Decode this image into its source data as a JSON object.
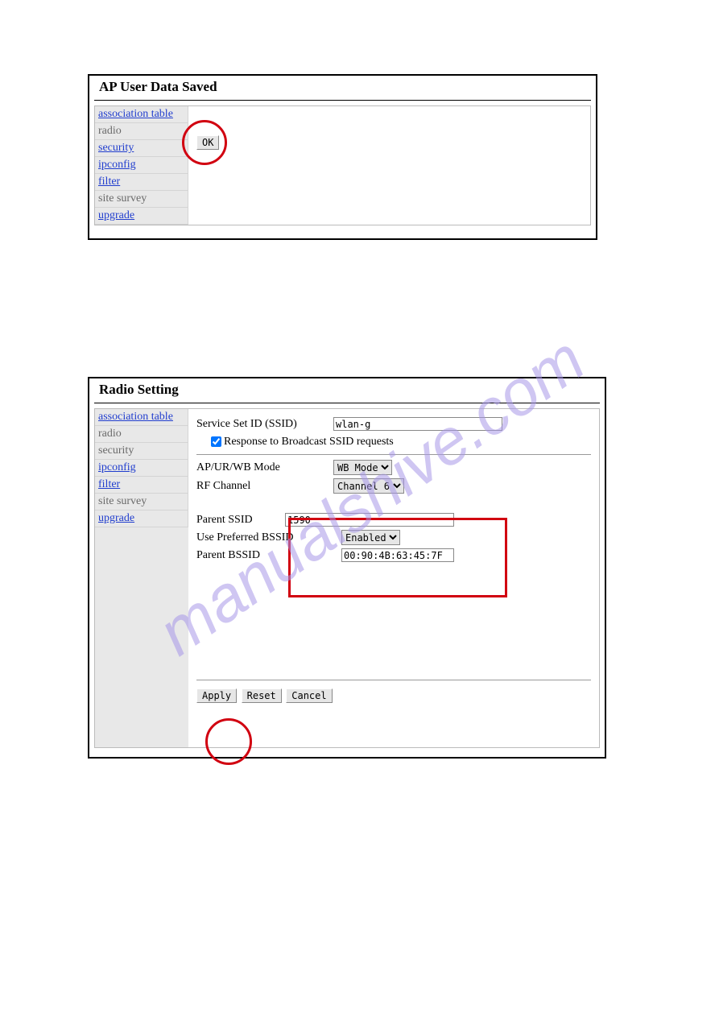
{
  "watermark": "manualshive.com",
  "panel1": {
    "title": "AP User Data Saved",
    "sidebar": [
      {
        "label": "association table",
        "style": "link"
      },
      {
        "label": "radio",
        "style": "plain"
      },
      {
        "label": "security",
        "style": "link"
      },
      {
        "label": "ipconfig",
        "style": "link"
      },
      {
        "label": "filter",
        "style": "link"
      },
      {
        "label": "site survey",
        "style": "plain"
      },
      {
        "label": "upgrade",
        "style": "link"
      }
    ],
    "ok_label": "OK"
  },
  "panel2": {
    "title": "Radio Setting",
    "sidebar": [
      {
        "label": "association table",
        "style": "link"
      },
      {
        "label": "radio",
        "style": "plain"
      },
      {
        "label": "security",
        "style": "plain"
      },
      {
        "label": "ipconfig",
        "style": "link"
      },
      {
        "label": "filter",
        "style": "link"
      },
      {
        "label": "site survey",
        "style": "plain"
      },
      {
        "label": "upgrade",
        "style": "link"
      }
    ],
    "ssid_label": "Service Set ID (SSID)",
    "ssid_value": "wlan-g",
    "response_checked": true,
    "response_label": "Response to Broadcast SSID requests",
    "mode_label": "AP/UR/WB Mode",
    "mode_value": "WB Mode",
    "rf_label": "RF Channel",
    "rf_value": "Channel 6",
    "parent_ssid_label": "Parent SSID",
    "parent_ssid_value": "1590",
    "use_pref_label": "Use Preferred BSSID",
    "use_pref_value": "Enabled",
    "parent_bssid_label": "Parent BSSID",
    "parent_bssid_value": "00:90:4B:63:45:7F",
    "buttons": {
      "apply": "Apply",
      "reset": "Reset",
      "cancel": "Cancel"
    }
  }
}
